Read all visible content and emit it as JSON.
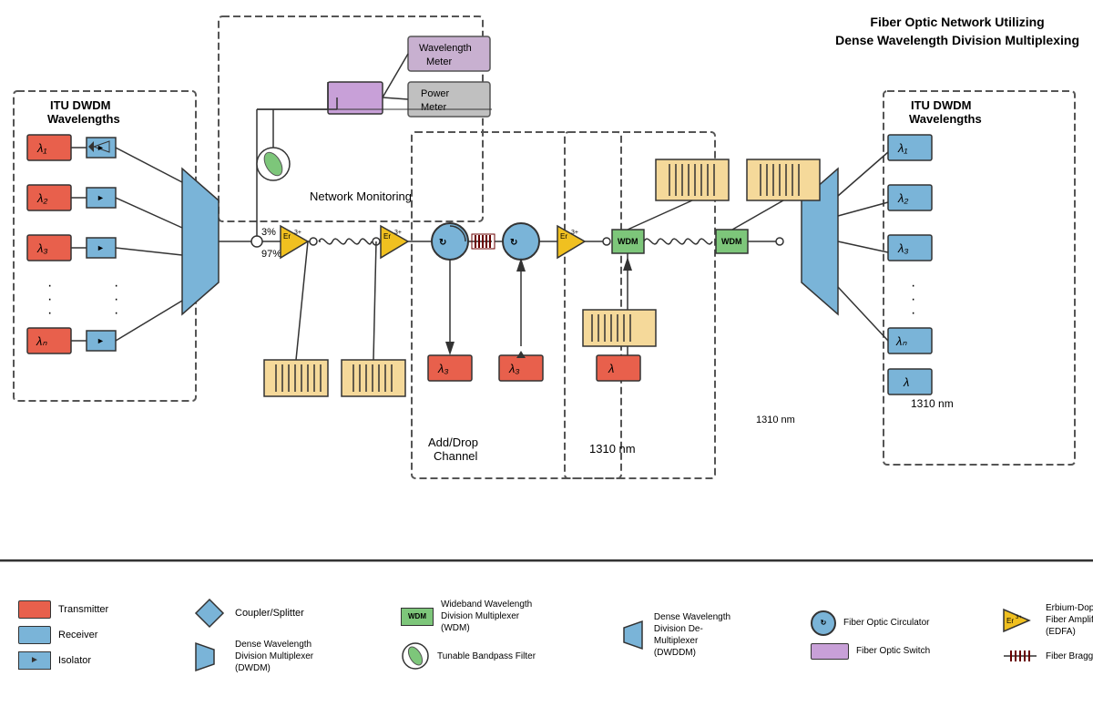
{
  "title": {
    "line1": "Fiber Optic Network Utilizing",
    "line2": "Dense Wavelength Division Multiplexing"
  },
  "left_itu": {
    "label": "ITU DWDM\nWavelengths",
    "channels": [
      "λ₁",
      "λ₂",
      "λ₃",
      "·",
      "λₙ"
    ]
  },
  "right_itu": {
    "label": "ITU DWDM\nWavelengths",
    "channels": [
      "λ₁",
      "λ₂",
      "λ₃",
      "·",
      "λₙ",
      "λ"
    ]
  },
  "network_monitoring": {
    "label": "Network Monitoring",
    "wavelength_meter": "Wavelength\nMeter",
    "power_meter": "Power\nMeter"
  },
  "add_drop": {
    "label": "Add/Drop\nChannel",
    "channel_add": "λ₃",
    "channel_drop": "λ₃"
  },
  "nm1310": {
    "label": "1310 nm",
    "channel": "λ"
  },
  "nm1310_right": {
    "label": "1310 nm",
    "channel": "λ"
  },
  "splitter_labels": {
    "three_pct": "3%",
    "ninetyseven_pct": "97%"
  },
  "amplifier_label": "Er³⁺",
  "legend": {
    "transmitter": "Transmitter",
    "receiver": "Receiver",
    "isolator": "Isolator",
    "coupler_splitter": "Coupler/Splitter",
    "dwdm": "Dense Wavelength\nDivision Multiplexer\n(DWDM)",
    "wdm": "Wideband Wavelength\nDivision Multiplexer\n(WDM)",
    "filter": "Tunable Bandpass\nFilter",
    "dwddm": "Dense Wavelength\nDivision De-Multiplexer\n(DWDDM)",
    "circulator": "Fiber Optic\nCirculator",
    "switch": "Fiber Optic\nSwitch",
    "edfa": "Erbium-Doped\nFiber Amplifier\n(EDFA)",
    "bragg": "Fiber Bragg\nGrating"
  }
}
